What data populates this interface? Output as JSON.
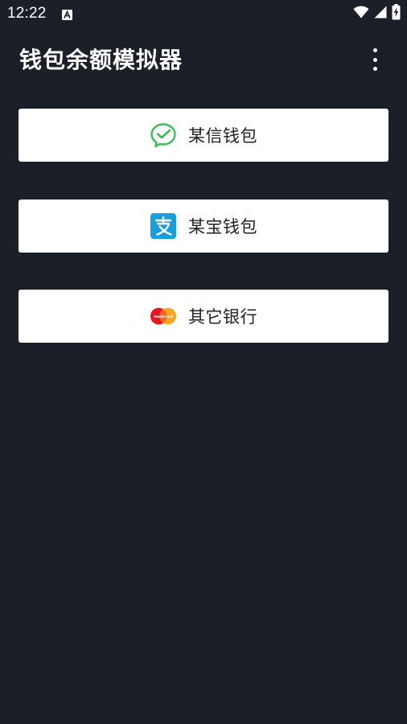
{
  "status_bar": {
    "time": "12:22",
    "icons": [
      "notification-a-icon",
      "wifi-icon",
      "signal-icon",
      "battery-charging-icon"
    ]
  },
  "app_bar": {
    "title": "钱包余额模拟器",
    "menu_icon": "more-vert-icon"
  },
  "wallets": [
    {
      "label": "某信钱包",
      "icon": "wechat-icon",
      "accent": "#3dbb54"
    },
    {
      "label": "某宝钱包",
      "icon": "alipay-icon",
      "accent": "#1a9fdb"
    },
    {
      "label": "其它银行",
      "icon": "mastercard-icon",
      "accent": "#e8141f"
    }
  ],
  "colors": {
    "background": "#1b1f27",
    "card": "#ffffff",
    "text_dark": "#222222"
  }
}
